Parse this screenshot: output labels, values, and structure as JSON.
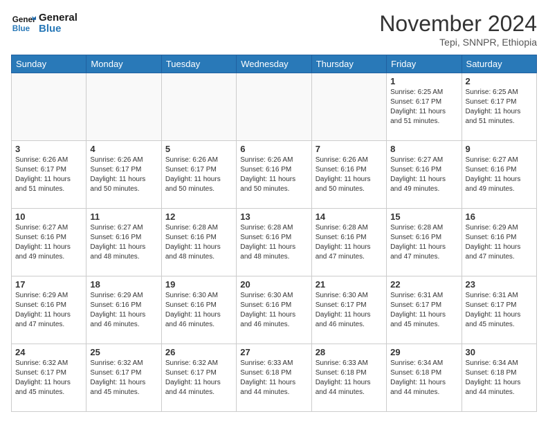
{
  "header": {
    "logo_line1": "General",
    "logo_line2": "Blue",
    "month_title": "November 2024",
    "location": "Tepi, SNNPR, Ethiopia"
  },
  "weekdays": [
    "Sunday",
    "Monday",
    "Tuesday",
    "Wednesday",
    "Thursday",
    "Friday",
    "Saturday"
  ],
  "weeks": [
    [
      {
        "day": "",
        "info": ""
      },
      {
        "day": "",
        "info": ""
      },
      {
        "day": "",
        "info": ""
      },
      {
        "day": "",
        "info": ""
      },
      {
        "day": "",
        "info": ""
      },
      {
        "day": "1",
        "info": "Sunrise: 6:25 AM\nSunset: 6:17 PM\nDaylight: 11 hours\nand 51 minutes."
      },
      {
        "day": "2",
        "info": "Sunrise: 6:25 AM\nSunset: 6:17 PM\nDaylight: 11 hours\nand 51 minutes."
      }
    ],
    [
      {
        "day": "3",
        "info": "Sunrise: 6:26 AM\nSunset: 6:17 PM\nDaylight: 11 hours\nand 51 minutes."
      },
      {
        "day": "4",
        "info": "Sunrise: 6:26 AM\nSunset: 6:17 PM\nDaylight: 11 hours\nand 50 minutes."
      },
      {
        "day": "5",
        "info": "Sunrise: 6:26 AM\nSunset: 6:17 PM\nDaylight: 11 hours\nand 50 minutes."
      },
      {
        "day": "6",
        "info": "Sunrise: 6:26 AM\nSunset: 6:16 PM\nDaylight: 11 hours\nand 50 minutes."
      },
      {
        "day": "7",
        "info": "Sunrise: 6:26 AM\nSunset: 6:16 PM\nDaylight: 11 hours\nand 50 minutes."
      },
      {
        "day": "8",
        "info": "Sunrise: 6:27 AM\nSunset: 6:16 PM\nDaylight: 11 hours\nand 49 minutes."
      },
      {
        "day": "9",
        "info": "Sunrise: 6:27 AM\nSunset: 6:16 PM\nDaylight: 11 hours\nand 49 minutes."
      }
    ],
    [
      {
        "day": "10",
        "info": "Sunrise: 6:27 AM\nSunset: 6:16 PM\nDaylight: 11 hours\nand 49 minutes."
      },
      {
        "day": "11",
        "info": "Sunrise: 6:27 AM\nSunset: 6:16 PM\nDaylight: 11 hours\nand 48 minutes."
      },
      {
        "day": "12",
        "info": "Sunrise: 6:28 AM\nSunset: 6:16 PM\nDaylight: 11 hours\nand 48 minutes."
      },
      {
        "day": "13",
        "info": "Sunrise: 6:28 AM\nSunset: 6:16 PM\nDaylight: 11 hours\nand 48 minutes."
      },
      {
        "day": "14",
        "info": "Sunrise: 6:28 AM\nSunset: 6:16 PM\nDaylight: 11 hours\nand 47 minutes."
      },
      {
        "day": "15",
        "info": "Sunrise: 6:28 AM\nSunset: 6:16 PM\nDaylight: 11 hours\nand 47 minutes."
      },
      {
        "day": "16",
        "info": "Sunrise: 6:29 AM\nSunset: 6:16 PM\nDaylight: 11 hours\nand 47 minutes."
      }
    ],
    [
      {
        "day": "17",
        "info": "Sunrise: 6:29 AM\nSunset: 6:16 PM\nDaylight: 11 hours\nand 47 minutes."
      },
      {
        "day": "18",
        "info": "Sunrise: 6:29 AM\nSunset: 6:16 PM\nDaylight: 11 hours\nand 46 minutes."
      },
      {
        "day": "19",
        "info": "Sunrise: 6:30 AM\nSunset: 6:16 PM\nDaylight: 11 hours\nand 46 minutes."
      },
      {
        "day": "20",
        "info": "Sunrise: 6:30 AM\nSunset: 6:16 PM\nDaylight: 11 hours\nand 46 minutes."
      },
      {
        "day": "21",
        "info": "Sunrise: 6:30 AM\nSunset: 6:17 PM\nDaylight: 11 hours\nand 46 minutes."
      },
      {
        "day": "22",
        "info": "Sunrise: 6:31 AM\nSunset: 6:17 PM\nDaylight: 11 hours\nand 45 minutes."
      },
      {
        "day": "23",
        "info": "Sunrise: 6:31 AM\nSunset: 6:17 PM\nDaylight: 11 hours\nand 45 minutes."
      }
    ],
    [
      {
        "day": "24",
        "info": "Sunrise: 6:32 AM\nSunset: 6:17 PM\nDaylight: 11 hours\nand 45 minutes."
      },
      {
        "day": "25",
        "info": "Sunrise: 6:32 AM\nSunset: 6:17 PM\nDaylight: 11 hours\nand 45 minutes."
      },
      {
        "day": "26",
        "info": "Sunrise: 6:32 AM\nSunset: 6:17 PM\nDaylight: 11 hours\nand 44 minutes."
      },
      {
        "day": "27",
        "info": "Sunrise: 6:33 AM\nSunset: 6:18 PM\nDaylight: 11 hours\nand 44 minutes."
      },
      {
        "day": "28",
        "info": "Sunrise: 6:33 AM\nSunset: 6:18 PM\nDaylight: 11 hours\nand 44 minutes."
      },
      {
        "day": "29",
        "info": "Sunrise: 6:34 AM\nSunset: 6:18 PM\nDaylight: 11 hours\nand 44 minutes."
      },
      {
        "day": "30",
        "info": "Sunrise: 6:34 AM\nSunset: 6:18 PM\nDaylight: 11 hours\nand 44 minutes."
      }
    ]
  ]
}
